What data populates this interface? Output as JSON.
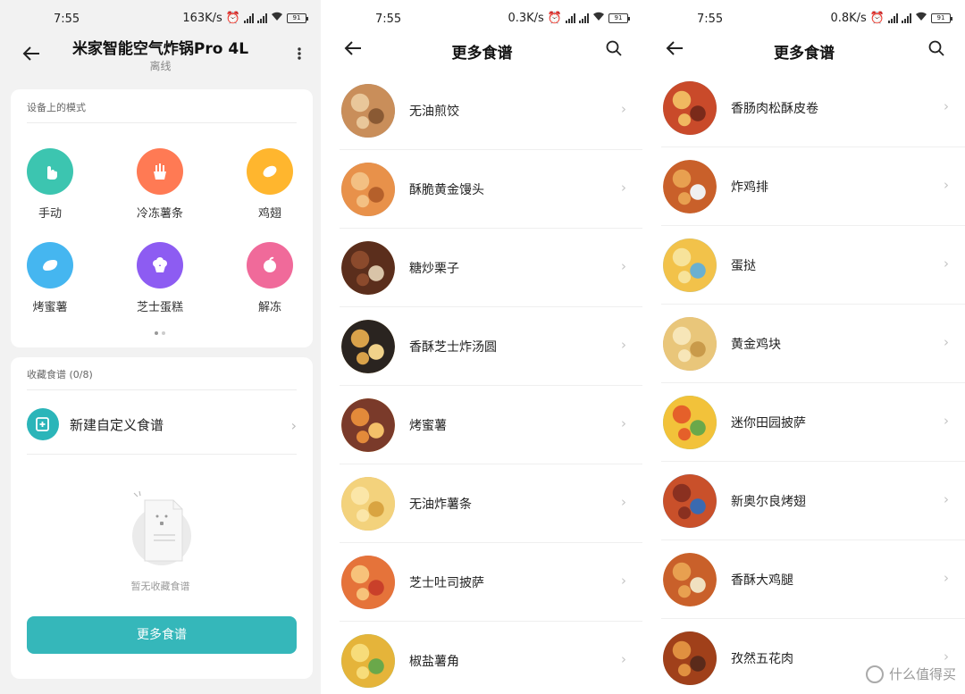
{
  "screen1": {
    "status": {
      "time": "7:55",
      "speed": "163K/s",
      "battery": "91"
    },
    "header": {
      "title": "米家智能空气炸锅Pro 4L",
      "subtitle": "离线"
    },
    "modes_card": {
      "title": "设备上的模式",
      "modes": [
        {
          "label": "手动",
          "icon": "hand-pointer-icon",
          "color": "#3cc5b0"
        },
        {
          "label": "冷冻薯条",
          "icon": "fries-icon",
          "color": "#ff7a54"
        },
        {
          "label": "鸡翅",
          "icon": "chicken-wing-icon",
          "color": "#ffb62e"
        },
        {
          "label": "烤蜜薯",
          "icon": "sweet-potato-icon",
          "color": "#45b6f0"
        },
        {
          "label": "芝士蛋糕",
          "icon": "cheesecake-icon",
          "color": "#8d5cf2"
        },
        {
          "label": "解冻",
          "icon": "thaw-icon",
          "color": "#f06a9a"
        }
      ]
    },
    "favorites_card": {
      "title": "收藏食谱 (0/8)",
      "new_custom": "新建自定义食谱",
      "empty_text": "暂无收藏食谱",
      "more_button": "更多食谱"
    }
  },
  "screen2": {
    "status": {
      "time": "7:55",
      "speed": "0.3K/s",
      "battery": "91"
    },
    "header": {
      "title": "更多食谱"
    },
    "items": [
      {
        "name": "无油煎饺",
        "palette": [
          "#c98e5a",
          "#e9c79a",
          "#8a5a34"
        ]
      },
      {
        "name": "酥脆黄金馒头",
        "palette": [
          "#e8914a",
          "#f3c083",
          "#b5602b"
        ]
      },
      {
        "name": "糖炒栗子",
        "palette": [
          "#5b2e1c",
          "#8b4a2c",
          "#d9c4a8"
        ]
      },
      {
        "name": "香酥芝士炸汤圆",
        "palette": [
          "#2a2420",
          "#d9a24a",
          "#f0d28a"
        ]
      },
      {
        "name": "烤蜜薯",
        "palette": [
          "#7a3a2a",
          "#e38a3a",
          "#f4c069"
        ]
      },
      {
        "name": "无油炸薯条",
        "palette": [
          "#f3d27c",
          "#fbe6a8",
          "#d9a441"
        ]
      },
      {
        "name": "芝士吐司披萨",
        "palette": [
          "#e5733a",
          "#f7c27a",
          "#c9402a"
        ]
      },
      {
        "name": "椒盐薯角",
        "palette": [
          "#e5b43a",
          "#f7dc7a",
          "#6aa84a"
        ]
      }
    ]
  },
  "screen3": {
    "status": {
      "time": "7:55",
      "speed": "0.8K/s",
      "battery": "91"
    },
    "header": {
      "title": "更多食谱"
    },
    "items": [
      {
        "name": "香肠肉松酥皮卷",
        "palette": [
          "#c94a2a",
          "#f0b860",
          "#7a2a1a"
        ]
      },
      {
        "name": "炸鸡排",
        "palette": [
          "#c9602a",
          "#e8a050",
          "#f0f0f0"
        ]
      },
      {
        "name": "蛋挞",
        "palette": [
          "#f2c24a",
          "#f7e39a",
          "#6ab0d0"
        ]
      },
      {
        "name": "黄金鸡块",
        "palette": [
          "#e9c67a",
          "#f7e6b8",
          "#c99a4a"
        ]
      },
      {
        "name": "迷你田园披萨",
        "palette": [
          "#f2c23a",
          "#e5602a",
          "#6aa84a"
        ]
      },
      {
        "name": "新奥尔良烤翅",
        "palette": [
          "#c9502a",
          "#8a3020",
          "#3a6ab0"
        ]
      },
      {
        "name": "香酥大鸡腿",
        "palette": [
          "#c9602a",
          "#e8a050",
          "#f0e0c0"
        ]
      },
      {
        "name": "孜然五花肉",
        "palette": [
          "#a0401a",
          "#e09040",
          "#5a2a1a"
        ]
      }
    ]
  },
  "watermark": {
    "text": "什么值得买"
  }
}
